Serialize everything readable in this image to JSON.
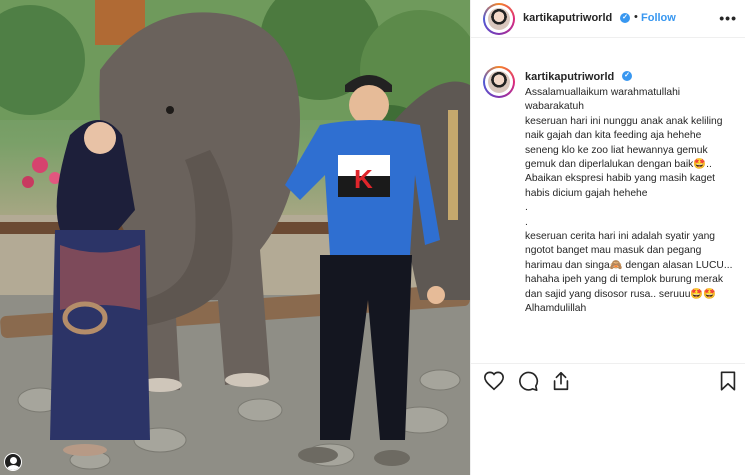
{
  "post": {
    "username": "kartikaputriworld",
    "verified_symbol": "✓",
    "separator": "•",
    "follow_label": "Follow",
    "more_label": "•••",
    "caption": "Assalamuallaikum warahmatullahi wabarakatuh\nkeseruan hari ini nunggu anak anak keliling naik gajah dan kita feeding aja hehehe seneng klo ke zoo liat hewannya gemuk gemuk dan diperlalukan dengan baik🤩.. Abaikan ekspresi habib yang masih kaget habis dicium gajah hehehe\n.\n.\nkeseruan cerita hari ini adalah syatir yang ngotot banget mau masuk dan pegang harimau dan singa🙈 dengan alasan LUCU... hahaha ipeh yang di templok burung merak dan sajid yang disosor rusa.. seruuu🤩🤩\nAlhamdulillah"
  },
  "photo": {
    "sweater_logo": "K"
  },
  "icons": {
    "like": "heart-icon",
    "comment": "comment-icon",
    "share": "share-icon",
    "save": "bookmark-icon",
    "verified": "verified-badge-icon",
    "more": "more-options-icon"
  },
  "colors": {
    "accent": "#3897f0",
    "text": "#262626",
    "border": "#efefef",
    "sweater": "#2f6fd1",
    "logo_red": "#e0252b"
  }
}
